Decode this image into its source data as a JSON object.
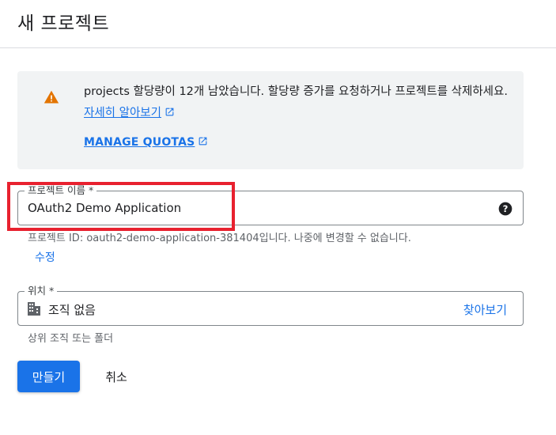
{
  "page": {
    "title": "새 프로젝트"
  },
  "notice": {
    "message": "projects 할당량이 12개 남았습니다. 할당량 증가를 요청하거나 프로젝트를 삭제하세요.",
    "learn_more": "자세히 알아보기",
    "manage_quotas": "MANAGE QUOTAS",
    "icon": "warning-icon",
    "icon_color": "#e37400"
  },
  "project_name": {
    "label": "프로젝트 이름 *",
    "value": "OAuth2 Demo Application",
    "hint": "프로젝트 ID: oauth2-demo-application-381404입니다. 나중에 변경할 수 없습니다.",
    "edit_label": "수정",
    "help_icon": "help-icon"
  },
  "location": {
    "label": "위치 *",
    "value": "조직 없음",
    "browse_label": "찾아보기",
    "hint": "상위 조직 또는 폴더",
    "icon": "building-icon"
  },
  "actions": {
    "create_label": "만들기",
    "cancel_label": "취소"
  },
  "colors": {
    "accent": "#1a73e8",
    "highlight_box": "#e8212f",
    "notice_bg": "#f1f3f4"
  }
}
